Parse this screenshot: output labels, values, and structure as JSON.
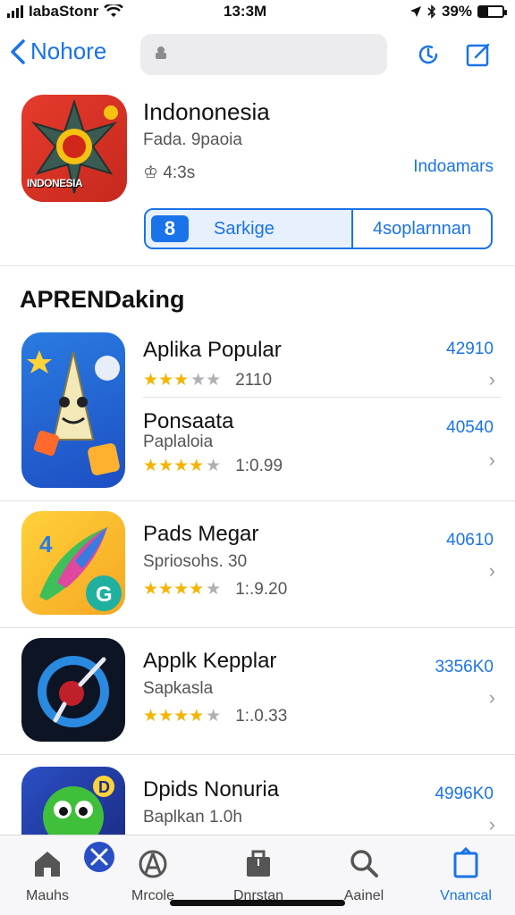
{
  "status": {
    "carrier": "IabaStonr",
    "time": "13:3M",
    "battery": "39%",
    "battery_level": 0.39
  },
  "nav": {
    "back_label": "Nohore"
  },
  "featured": {
    "title": "Indononesia",
    "subtitle": "Fada. 9paoia",
    "meta": "4:3s",
    "link": "Indoamars",
    "icon_text": "INDONESIA",
    "segment_left": "Sarkige",
    "segment_right": "4soplarnnan"
  },
  "section": {
    "title": "APRENDaking"
  },
  "apps": [
    {
      "name": "Aplika Popular",
      "subtitle": "",
      "rating": "2110",
      "stars": 3.5,
      "price": "42910",
      "icon": "rocket-character-icon"
    },
    {
      "name": "Ponsaata",
      "subtitle": "Paplaloia",
      "rating": "1:0.99",
      "stars": 4,
      "price": "40540",
      "icon": ""
    },
    {
      "name": "Pads Megar",
      "subtitle": "Spriosohs. 30",
      "rating": "1:.9.20",
      "stars": 4,
      "price": "40610",
      "icon": "rocket-icon"
    },
    {
      "name": "Applk Kepplar",
      "subtitle": "Sapkasla",
      "rating": "1:.0.33",
      "stars": 4,
      "price": "3356K0",
      "icon": "compass-icon"
    },
    {
      "name": "Dpids Nonuria",
      "subtitle": "Baplkan 1.0h",
      "rating": "",
      "stars": 0,
      "price": "4996K0",
      "icon": "monster-icon"
    }
  ],
  "tabs": [
    {
      "label": "Mauhs",
      "icon": "home-icon"
    },
    {
      "label": "Mrcole",
      "icon": "apps-icon"
    },
    {
      "label": "Dnrstan",
      "icon": "bag-icon"
    },
    {
      "label": "Aainel",
      "icon": "search-icon"
    },
    {
      "label": "Vnancal",
      "icon": "updates-icon"
    }
  ],
  "colors": {
    "accent": "#1a73e8",
    "star": "#f5b400"
  }
}
